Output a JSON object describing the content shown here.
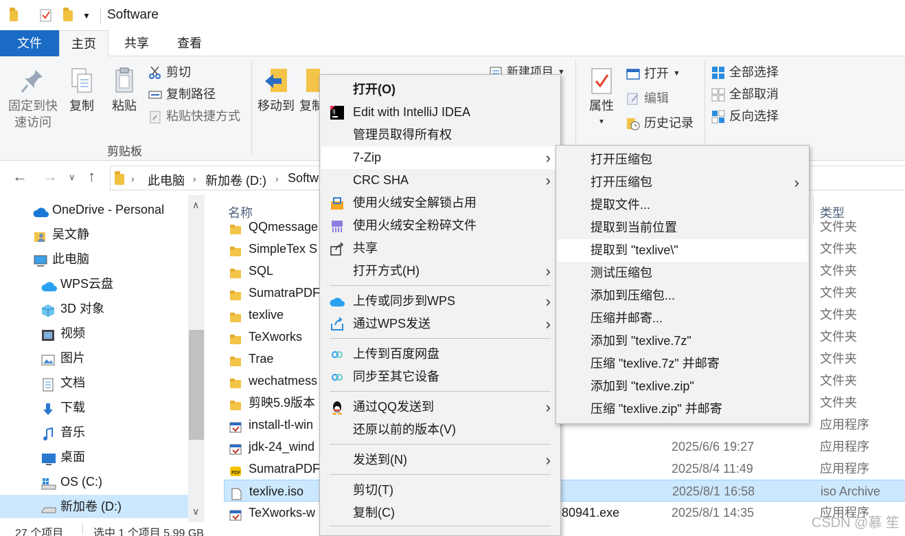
{
  "window": {
    "title": "Software"
  },
  "ribbon_tabs": [
    "文件",
    "主页",
    "共享",
    "查看"
  ],
  "ribbon": {
    "pin_label_1": "固定到快",
    "pin_label_2": "速访问",
    "copy": "复制",
    "paste": "粘贴",
    "cut": "剪切",
    "copy_path": "复制路径",
    "paste_shortcut": "粘贴快捷方式",
    "clipboard_group": "剪贴板",
    "move_to": "移动到",
    "copy_to_partial": "复制",
    "new_item": "新建项目",
    "properties": "属性",
    "open": "打开",
    "edit": "编辑",
    "history": "历史记录",
    "select_all": "全部选择",
    "select_none": "全部取消",
    "invert_selection": "反向选择"
  },
  "address": {
    "crumbs": [
      "此电脑",
      "新加卷 (D:)",
      "Softw"
    ]
  },
  "nav": {
    "items": [
      {
        "label": "OneDrive - Personal",
        "icon": "cloud-icon"
      },
      {
        "label": "吴文静",
        "icon": "user-icon"
      },
      {
        "label": "此电脑",
        "icon": "computer-icon"
      },
      {
        "label": "WPS云盘",
        "icon": "wps-cloud-icon"
      },
      {
        "label": "3D 对象",
        "icon": "cube-icon"
      },
      {
        "label": "视频",
        "icon": "video-icon"
      },
      {
        "label": "图片",
        "icon": "picture-icon"
      },
      {
        "label": "文档",
        "icon": "document-icon"
      },
      {
        "label": "下载",
        "icon": "download-icon"
      },
      {
        "label": "音乐",
        "icon": "music-icon"
      },
      {
        "label": "桌面",
        "icon": "desktop-icon"
      },
      {
        "label": "OS (C:)",
        "icon": "drive-icon"
      },
      {
        "label": "新加卷 (D:)",
        "icon": "drive-icon"
      }
    ]
  },
  "filelist": {
    "headers": {
      "name": "名称",
      "type": "类型"
    },
    "rows": [
      {
        "name": "QQmessage",
        "date": "",
        "type": "文件夹",
        "icon": "folder"
      },
      {
        "name": "SimpleTex S",
        "date": "",
        "type": "文件夹",
        "icon": "folder"
      },
      {
        "name": "SQL",
        "date": "",
        "type": "文件夹",
        "icon": "folder"
      },
      {
        "name": "SumatraPDF",
        "date": "",
        "type": "文件夹",
        "icon": "folder"
      },
      {
        "name": "texlive",
        "date": "",
        "type": "文件夹",
        "icon": "folder"
      },
      {
        "name": "TeXworks",
        "date": "",
        "type": "文件夹",
        "icon": "folder"
      },
      {
        "name": "Trae",
        "date": "",
        "type": "文件夹",
        "icon": "folder"
      },
      {
        "name": "wechatmess",
        "date": "",
        "type": "文件夹",
        "icon": "folder"
      },
      {
        "name": "剪映5.9版本",
        "date": "",
        "type": "文件夹",
        "icon": "folder"
      },
      {
        "name": "install-tl-win",
        "date": "",
        "type": "应用程序",
        "icon": "exe"
      },
      {
        "name": "jdk-24_wind",
        "date": "2025/6/6 19:27",
        "type": "应用程序",
        "icon": "exe"
      },
      {
        "name": "SumatraPDF",
        "date": "2025/8/4 11:49",
        "type": "应用程序",
        "icon": "pdf"
      },
      {
        "name": "texlive.iso",
        "date": "2025/8/1 16:58",
        "type": "iso Archive",
        "icon": "file"
      },
      {
        "name": "TeXworks-w",
        "name_tail": "380941.exe",
        "date": "2025/8/1 14:35",
        "type": "应用程序",
        "icon": "exe"
      }
    ]
  },
  "status": {
    "count": "27 个项目",
    "selection": "选中 1 个项目 5.99 GB"
  },
  "context_menu": {
    "items": [
      {
        "label": "打开(O)",
        "bold": true
      },
      {
        "label": "Edit with IntelliJ IDEA",
        "icon": "intellij-icon"
      },
      {
        "label": "管理员取得所有权"
      },
      {
        "label": "7-Zip",
        "submenu": true
      },
      {
        "label": "CRC SHA",
        "submenu": true
      },
      {
        "label": "使用火绒安全解锁占用",
        "icon": "huorong-unlock-icon"
      },
      {
        "label": "使用火绒安全粉碎文件",
        "icon": "huorong-shred-icon"
      },
      {
        "label": "共享",
        "icon": "share-icon"
      },
      {
        "label": "打开方式(H)",
        "submenu": true
      },
      {
        "label": "上传或同步到WPS",
        "icon": "wps-cloud-icon",
        "submenu": true
      },
      {
        "label": "通过WPS发送",
        "icon": "wps-send-icon",
        "submenu": true
      },
      {
        "label": "上传到百度网盘",
        "icon": "baidu-icon"
      },
      {
        "label": "同步至其它设备",
        "icon": "baidu-icon"
      },
      {
        "label": "通过QQ发送到",
        "icon": "qq-icon",
        "submenu": true
      },
      {
        "label": "还原以前的版本(V)"
      },
      {
        "label": "发送到(N)",
        "submenu": true
      },
      {
        "label": "剪切(T)"
      },
      {
        "label": "复制(C)"
      }
    ]
  },
  "zip_submenu": {
    "items": [
      "打开压缩包",
      "打开压缩包",
      "提取文件...",
      "提取到当前位置",
      "提取到 \"texlive\\\"",
      "测试压缩包",
      "添加到压缩包...",
      "压缩并邮寄...",
      "添加到 \"texlive.7z\"",
      "压缩 \"texlive.7z\" 并邮寄",
      "添加到 \"texlive.zip\"",
      "压缩 \"texlive.zip\" 并邮寄"
    ]
  },
  "watermark": "CSDN @慕    笙",
  "colors": {
    "accent": "#1a6bc4",
    "selection": "#cce8ff",
    "menu_bg": "#f2f2f2"
  }
}
